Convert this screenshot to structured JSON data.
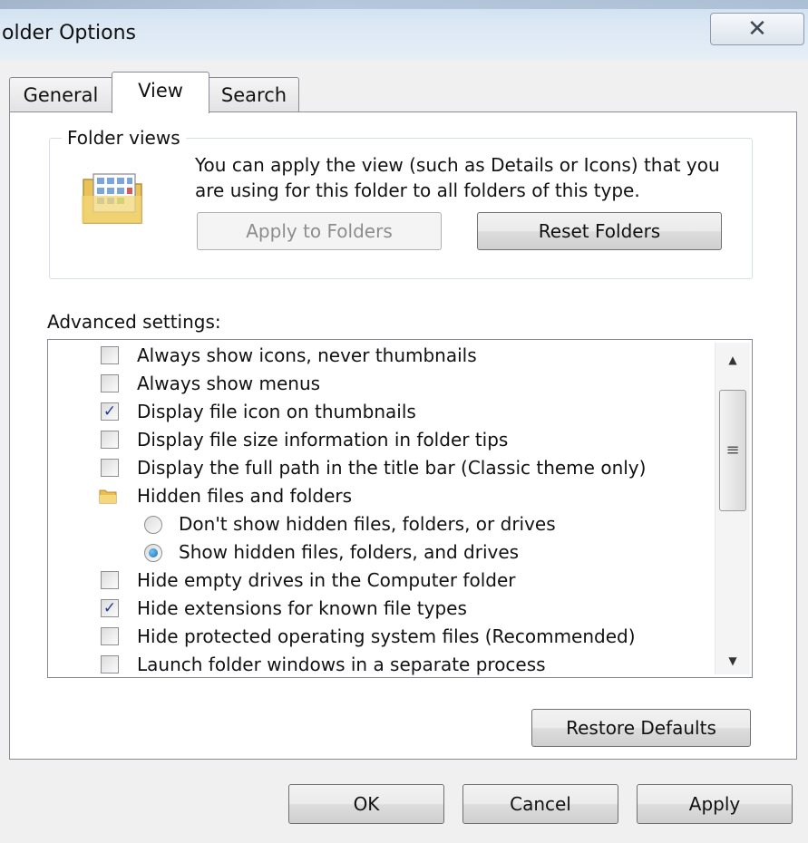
{
  "window": {
    "title": "older Options",
    "close_glyph": "✕"
  },
  "tabs": [
    {
      "label": "General",
      "selected": false
    },
    {
      "label": "View",
      "selected": true
    },
    {
      "label": "Search",
      "selected": false
    }
  ],
  "folder_views": {
    "group_label": "Folder views",
    "icon": "folder-view-icon",
    "description": "You can apply the view (such as Details or Icons) that you are using for this folder to all folders of this type.",
    "apply_button": "Apply to Folders",
    "apply_enabled": false,
    "reset_button": "Reset Folders"
  },
  "advanced": {
    "label": "Advanced settings:",
    "items": [
      {
        "type": "checkbox",
        "label": "Always show icons, never thumbnails",
        "checked": false
      },
      {
        "type": "checkbox",
        "label": "Always show menus",
        "checked": false
      },
      {
        "type": "checkbox",
        "label": "Display file icon on thumbnails",
        "checked": true
      },
      {
        "type": "checkbox",
        "label": "Display file size information in folder tips",
        "checked": false
      },
      {
        "type": "checkbox",
        "label": "Display the full path in the title bar (Classic theme only)",
        "checked": false
      },
      {
        "type": "folder",
        "label": "Hidden files and folders",
        "icon": "folder-icon"
      },
      {
        "type": "radio",
        "label": "Don't show hidden files, folders, or drives",
        "checked": false
      },
      {
        "type": "radio",
        "label": "Show hidden files, folders, and drives",
        "checked": true
      },
      {
        "type": "checkbox",
        "label": "Hide empty drives in the Computer folder",
        "checked": false
      },
      {
        "type": "checkbox",
        "label": "Hide extensions for known file types",
        "checked": true
      },
      {
        "type": "checkbox",
        "label": "Hide protected operating system files (Recommended)",
        "checked": false
      },
      {
        "type": "checkbox",
        "label": "Launch folder windows in a separate process",
        "checked": false
      }
    ],
    "restore_button": "Restore Defaults"
  },
  "footer": {
    "ok": "OK",
    "cancel": "Cancel",
    "apply": "Apply"
  }
}
